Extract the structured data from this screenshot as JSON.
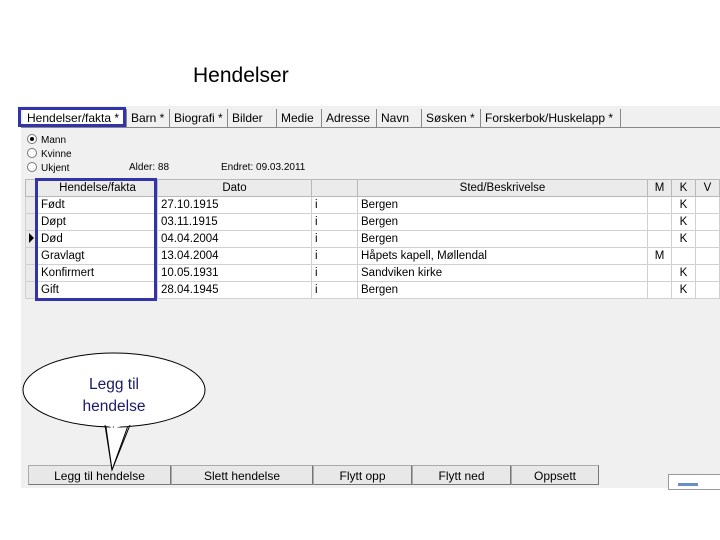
{
  "slide_title": "Hendelser",
  "tabs": [
    "Hendelser/fakta *",
    "Barn *",
    "Biografi *",
    "Bilder",
    "Medie",
    "Adresse",
    "Navn",
    "Søsken *",
    "Forskerbok/Huskelapp *"
  ],
  "gender": {
    "options": [
      "Mann",
      "Kvinne",
      "Ukjent"
    ],
    "selected": "Mann"
  },
  "age_label": "Alder: 88",
  "changed_label": "Endret: 09.03.2011",
  "table": {
    "headers": [
      "Hendelse/fakta",
      "Dato",
      "",
      "Sted/Beskrivelse",
      "M",
      "K",
      "V"
    ],
    "rows": [
      [
        "Født",
        "27.10.1915",
        "i",
        "Bergen",
        "",
        "K",
        ""
      ],
      [
        "Døpt",
        "03.11.1915",
        "i",
        "Bergen",
        "",
        "K",
        ""
      ],
      [
        "Død",
        "04.04.2004",
        "i",
        "Bergen",
        "",
        "K",
        ""
      ],
      [
        "Gravlagt",
        "13.04.2004",
        "i",
        "Håpets kapell, Møllendal",
        "M",
        "",
        ""
      ],
      [
        "Konfirmert",
        "10.05.1931",
        "i",
        "Sandviken kirke",
        "",
        "K",
        ""
      ],
      [
        "Gift",
        "28.04.1945",
        "i",
        "Bergen",
        "",
        "K",
        ""
      ]
    ],
    "current_row": 2
  },
  "buttons": [
    "Legg til hendelse",
    "Slett hendelse",
    "Flytt opp",
    "Flytt ned",
    "Oppsett"
  ],
  "callout": {
    "line1": "Legg til",
    "line2": "hendelse"
  },
  "colors": {
    "highlight": "#3333aa",
    "callout_text": "#1a1a6a"
  }
}
